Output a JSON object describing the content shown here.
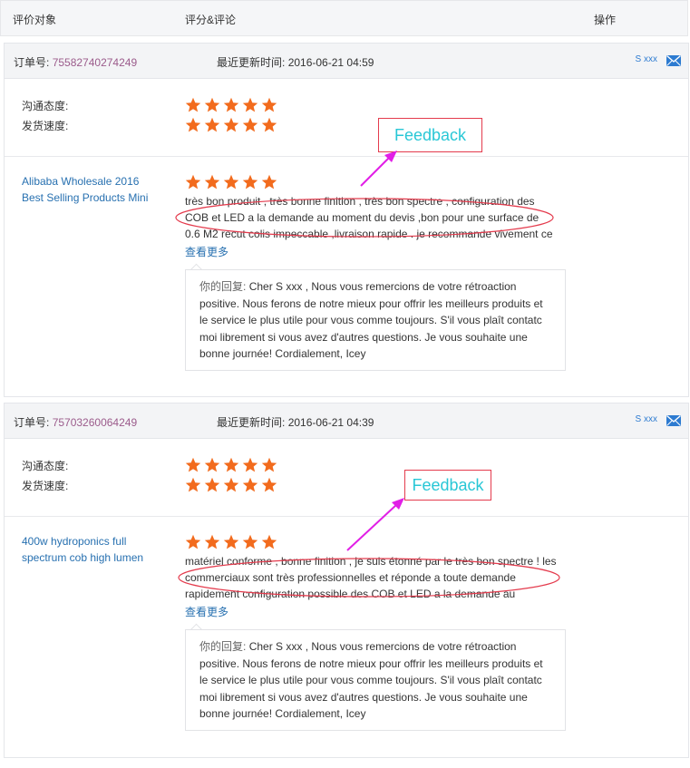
{
  "header": {
    "col_object": "评价对象",
    "col_rating": "评分&评论",
    "col_action": "操作"
  },
  "colors": {
    "star": "#f26b1d",
    "annotation_red": "#e43b4d",
    "annotation_magenta": "#e11fe6",
    "feedback_text": "#29c7d6",
    "link_blue": "#2770b0",
    "order_id": "#9b5b8b"
  },
  "orders": [
    {
      "order_label": "订单号:",
      "order_id": "75582740274249",
      "updated_label": "最近更新时间:",
      "updated_value": "2016-06-21 04:59",
      "buyer": "S xxx",
      "ratings": [
        {
          "label": "沟通态度:",
          "stars": 5
        },
        {
          "label": "发货速度:",
          "stars": 5
        }
      ],
      "product_title": "Alibaba Wholesale 2016 Best Selling Products Mini",
      "product_stars": 5,
      "review_text": "très bon produit , très bonne finition , très bon spectre , configuration des COB et LED a la demande au moment du devis ,bon pour une surface de 0.6 M2 recut colis impeccable ,livraison rapide . je recommande vivement ce",
      "more_label": "查看更多",
      "reply_prefix": "你的回复:",
      "reply_text": "Cher S xxx , Nous vous remercions de votre rétroaction positive. Nous ferons de notre mieux pour offrir les meilleurs produits et le service le plus utile pour vous comme toujours. S'il vous plaît contatc moi librement si vous avez d'autres questions. Je vous souhaite une bonne journée! Cordialement, Icey",
      "annotation": "Feedback"
    },
    {
      "order_label": "订单号:",
      "order_id": "75703260064249",
      "updated_label": "最近更新时间:",
      "updated_value": "2016-06-21 04:39",
      "buyer": "S xxx",
      "ratings": [
        {
          "label": "沟通态度:",
          "stars": 5
        },
        {
          "label": "发货速度:",
          "stars": 5
        }
      ],
      "product_title": "400w hydroponics full spectrum cob high lumen",
      "product_stars": 5,
      "review_text": "matériel conforme , bonne finition , je suis étonné par le très bon spectre ! les commerciaux sont très professionnelles et réponde a toute demande rapidement configuration possible des COB et LED a la demande au moment",
      "more_label": "查看更多",
      "reply_prefix": "你的回复:",
      "reply_text": "Cher S xxx , Nous vous remercions de votre rétroaction positive. Nous ferons de notre mieux pour offrir les meilleurs produits et le service le plus utile pour vous comme toujours. S'il vous plaît contatc moi librement si vous avez d'autres questions. Je vous souhaite une bonne journée! Cordialement, Icey",
      "annotation": "Feedback"
    }
  ]
}
